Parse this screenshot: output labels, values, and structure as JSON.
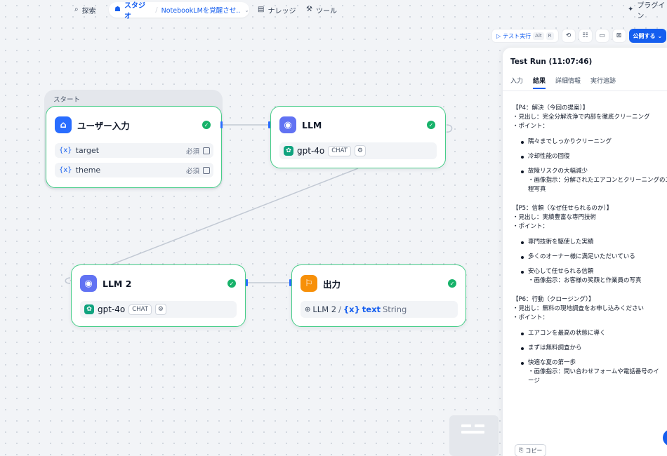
{
  "nav": {
    "explore": "探索",
    "studio": "スタジオ",
    "separator": "/",
    "app_name": "NotebookLMを覚醒させ...",
    "knowledge": "ナレッジ",
    "tools": "ツール",
    "plugins": "プラグイン"
  },
  "toolbar": {
    "test_run": "テスト実行",
    "kbd_alt": "Alt",
    "kbd_r": "R",
    "publish": "公開する"
  },
  "canvas": {
    "start_group_label": "スタート",
    "nodes": {
      "user_input": {
        "title": "ユーザー入力",
        "vars": [
          {
            "name": "target",
            "required": "必須"
          },
          {
            "name": "theme",
            "required": "必須"
          }
        ]
      },
      "llm": {
        "title": "LLM",
        "model": "gpt-4o",
        "mode": "CHAT"
      },
      "llm2": {
        "title": "LLM 2",
        "model": "gpt-4o",
        "mode": "CHAT"
      },
      "output": {
        "title": "出力",
        "source_node": "LLM 2",
        "var_name": "text",
        "var_type": "String"
      }
    }
  },
  "panel": {
    "title": "Test Run (11:07:46)",
    "tabs": [
      "入力",
      "結果",
      "詳細情報",
      "実行追跡"
    ],
    "active_tab": "結果",
    "sections": [
      {
        "heading": "【P4：解決（今回の提案）】",
        "lines": [
          "・見出し：完全分解洗浄で内部を徹底クリーニング",
          "・ポイント："
        ],
        "bullets": [
          {
            "text": "隅々までしっかりクリーニング"
          },
          {
            "text": "冷却性能の回復"
          },
          {
            "text": "故障リスクの大幅減少",
            "sub": "・画像指示：分解されたエアコンとクリーニングのエ",
            "sub2": "程写真"
          }
        ]
      },
      {
        "heading": "【P5：信頼（なぜ任せられるのか）】",
        "lines": [
          "・見出し：実績豊富な専門技術",
          "・ポイント："
        ],
        "bullets": [
          {
            "text": "専門技術を駆使した実績"
          },
          {
            "text": "多くのオーナー様に満足いただいている"
          },
          {
            "text": "安心して任せられる信頼",
            "sub": "・画像指示：お客様の笑顔と作業員の写真"
          }
        ]
      },
      {
        "heading": "【P6：行動（クロージング）】",
        "lines": [
          "・見出し：無料の現地調査をお申し込みください",
          "・ポイント："
        ],
        "bullets": [
          {
            "text": "エアコンを最高の状態に導く"
          },
          {
            "text": "まずは無料調査から"
          },
          {
            "text": "快適な夏の第一歩",
            "sub": "・画像指示：問い合わせフォームや電話番号のイ",
            "sub2": "ージ"
          }
        ]
      }
    ],
    "copy": "コピー"
  },
  "colors": {
    "accent": "#155eef",
    "success": "#17b26a",
    "node_border": "#47cd89"
  }
}
